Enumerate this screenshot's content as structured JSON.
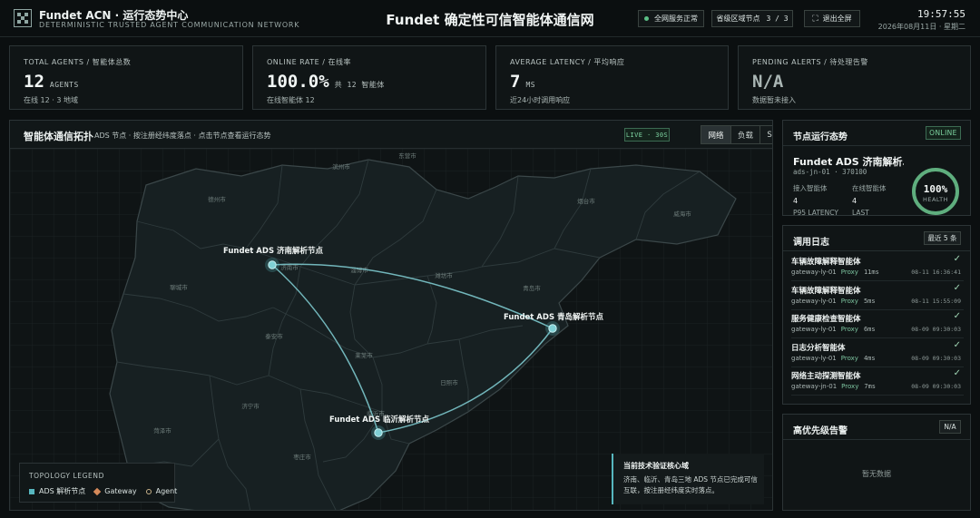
{
  "header": {
    "brand": "Fundet ACN · 运行态势中心",
    "brand_sub": "DETERMINISTIC TRUSTED AGENT COMMUNICATION NETWORK",
    "title": "Fundet 确定性可信智能体通信网",
    "status_pill": "全网服务正常",
    "status_color": "#5bbf85",
    "province_nodes_label": "省级区域节点",
    "province_nodes_value": "3 / 3",
    "exit_fullscreen": "退出全屏",
    "exit_icon": "fullscreen-exit-icon",
    "time": "19:57:55",
    "date": "2026年08月11日 · 星期二"
  },
  "stats": [
    {
      "label": "TOTAL AGENTS / 智能体总数",
      "value": "12",
      "unit": "AGENTS",
      "sub": "在线 12 · 3 地域"
    },
    {
      "label": "ONLINE RATE / 在线率",
      "value": "100.0%",
      "unit": "共 12 智能体",
      "sub": "在线智能体 12"
    },
    {
      "label": "AVERAGE LATENCY / 平均响应",
      "value": "7",
      "unit": "MS",
      "sub": "近24小时调用响应"
    },
    {
      "label": "PENDING ALERTS / 待处理告警",
      "value": "N/A",
      "unit": "",
      "sub": "数据暂未接入"
    }
  ],
  "topology": {
    "title": "智能体通信拓扑",
    "subtitle": "ADS 节点 · 按注册经纬度落点 · 点击节点查看运行态势",
    "live": "LIVE · 30S",
    "tabs": [
      "网络",
      "负载",
      "SLA"
    ],
    "accent": "#57b7bf",
    "node_labels": [
      "Fundet ADS 济南解析节点",
      "Fundet ADS 青岛解析节点",
      "Fundet ADS 临沂解析节点"
    ],
    "city_labels": [
      "滨州市",
      "东营市",
      "德州市",
      "烟台市",
      "威海市",
      "济南市",
      "淄博市",
      "潍坊市",
      "青岛市",
      "聊城市",
      "泰安市",
      "莱芜市",
      "日照市",
      "济宁市",
      "临沂市",
      "菏泽市",
      "枣庄市"
    ],
    "legend_title": "TOPOLOGY LEGEND",
    "legend_items": [
      "ADS 解析节点",
      "Gateway",
      "Agent"
    ],
    "note_title": "当前技术验证核心域",
    "note_text": "济南、临沂、青岛三地 ADS 节点已完成可信互联，按注册经纬度实时落点。"
  },
  "node_status": {
    "title": "节点运行态势",
    "badge": "ONLINE",
    "name": "Fundet ADS 济南解析…",
    "id": "ads-jn-01 · 370100",
    "kv": [
      {
        "k": "接入智能体",
        "v": "4"
      },
      {
        "k": "在线智能体",
        "v": "4"
      }
    ],
    "extra_labels": [
      "P95 LATENCY",
      "LAST"
    ],
    "health_value": 1.0,
    "health_text": "100%",
    "health_label": "HEALTH",
    "health_color": "#5fae7e"
  },
  "call_log": {
    "title": "调用日志",
    "filter": "最近 5 条",
    "items": [
      {
        "name": "车辆故障解释智能体",
        "gw": "gateway-ly-01",
        "type": "Proxy",
        "ms": "11ms",
        "time": "08-11 16:36:41"
      },
      {
        "name": "车辆故障解释智能体",
        "gw": "gateway-ly-01",
        "type": "Proxy",
        "ms": "5ms",
        "time": "08-11 15:55:09"
      },
      {
        "name": "服务健康检查智能体",
        "gw": "gateway-ly-01",
        "type": "Proxy",
        "ms": "6ms",
        "time": "08-09 09:30:03"
      },
      {
        "name": "日志分析智能体",
        "gw": "gateway-ly-01",
        "type": "Proxy",
        "ms": "4ms",
        "time": "08-09 09:30:03"
      },
      {
        "name": "网络主动探测智能体",
        "gw": "gateway-jn-01",
        "type": "Proxy",
        "ms": "7ms",
        "time": "08-09 09:30:03"
      }
    ]
  },
  "alerts": {
    "title": "高优先级告警",
    "badge": "N/A",
    "empty": "暂无数据"
  }
}
